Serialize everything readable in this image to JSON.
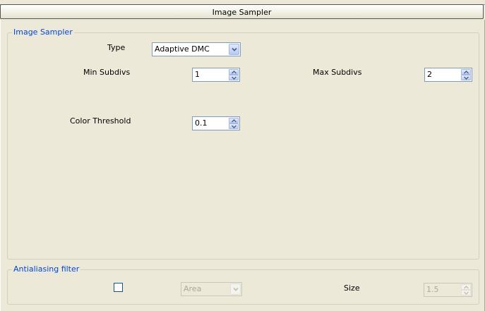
{
  "rollout": {
    "title": "Image Sampler"
  },
  "image_sampler": {
    "group_title": "Image Sampler",
    "type_label": "Type",
    "type_value": "Adaptive DMC",
    "min_subdivs_label": "Min Subdivs",
    "min_subdivs_value": "1",
    "max_subdivs_label": "Max Subdivs",
    "max_subdivs_value": "2",
    "color_threshold_label": "Color Threshold",
    "color_threshold_value": "0.1"
  },
  "antialiasing": {
    "group_title": "Antialiasing filter",
    "enabled": false,
    "filter_value": "Area",
    "size_label": "Size",
    "size_value": "1.5"
  },
  "colors": {
    "group_title": "#0046d5",
    "background": "#ece9d8"
  },
  "icons": {
    "dropdown": "chevron-down-icon",
    "spin_up": "arrow-up-icon",
    "spin_down": "arrow-down-icon"
  }
}
